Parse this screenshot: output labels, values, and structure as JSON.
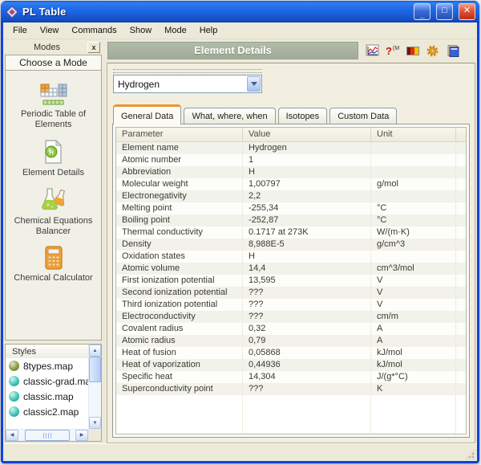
{
  "window": {
    "title": "PL Table",
    "controls": {
      "minimize": "_",
      "maximize": "□",
      "close": "✕"
    }
  },
  "menu": {
    "items": [
      "File",
      "View",
      "Commands",
      "Show",
      "Mode",
      "Help"
    ]
  },
  "sidebar": {
    "caption": "Modes",
    "close_label": "x",
    "header": "Choose a Mode",
    "modes": [
      {
        "label": "Periodic Table of Elements",
        "icon": "periodic-table-icon"
      },
      {
        "label": "Element Details",
        "icon": "element-details-icon"
      },
      {
        "label": "Chemical Equations Balancer",
        "icon": "flasks-icon"
      },
      {
        "label": "Chemical Calculator",
        "icon": "calculator-icon"
      }
    ],
    "styles_panel": {
      "title": "Styles",
      "items": [
        {
          "name": "8types.map",
          "color": "#8d9b43",
          "gloss": "#dfe8bf",
          "edge": "#57651f"
        },
        {
          "name": "classic-grad.map",
          "color": "#44c4b7",
          "gloss": "#d3f4ef",
          "edge": "#17776d"
        },
        {
          "name": "classic.map",
          "color": "#44c4b7",
          "gloss": "#d3f4ef",
          "edge": "#17776d"
        },
        {
          "name": "classic2.map",
          "color": "#44c4b7",
          "gloss": "#d3f4ef",
          "edge": "#17776d"
        }
      ]
    }
  },
  "main": {
    "header": "Element Details",
    "toolbar_icons": [
      "chart-icon",
      "query-language-icon",
      "flag-icon",
      "settings-gear-icon",
      "notebook-icon"
    ],
    "element_select": {
      "value": "Hydrogen"
    },
    "tabs": [
      {
        "label": "General Data",
        "active": true
      },
      {
        "label": "What, where, when",
        "active": false
      },
      {
        "label": "Isotopes",
        "active": false
      },
      {
        "label": "Custom Data",
        "active": false
      }
    ],
    "table": {
      "columns": [
        "Parameter",
        "Value",
        "Unit"
      ],
      "rows": [
        [
          "Element name",
          "Hydrogen",
          ""
        ],
        [
          "Atomic number",
          "1",
          ""
        ],
        [
          "Abbreviation",
          "H",
          ""
        ],
        [
          "Molecular weight",
          "1,00797",
          "g/mol"
        ],
        [
          "Electronegativity",
          "2,2",
          ""
        ],
        [
          "Melting point",
          "-255,34",
          "°C"
        ],
        [
          "Boiling point",
          "-252,87",
          "°C"
        ],
        [
          "Thermal conductivity",
          "0.1717 at 273K",
          "W/(m·K)"
        ],
        [
          "Density",
          "8,988E-5",
          "g/cm^3"
        ],
        [
          "Oxidation states",
          "H",
          ""
        ],
        [
          "Atomic volume",
          "14,4",
          "cm^3/mol"
        ],
        [
          "First ionization potential",
          "13,595",
          "V"
        ],
        [
          "Second ionization potential",
          "???",
          "V"
        ],
        [
          "Third ionization potential",
          "???",
          "V"
        ],
        [
          "Electroconductivity",
          "???",
          "cm/m"
        ],
        [
          "Covalent radius",
          "0,32",
          "A"
        ],
        [
          "Atomic radius",
          "0,79",
          "A"
        ],
        [
          "Heat of fusion",
          "0,05868",
          "kJ/mol"
        ],
        [
          "Heat of vaporization",
          "0,44936",
          "kJ/mol"
        ],
        [
          "Specific heat",
          "14,304",
          "J/(g*°C)"
        ],
        [
          "Superconductivity point",
          "???",
          "K"
        ]
      ]
    }
  },
  "colors": {
    "titlebar_blue": "#1a5edd",
    "frame_blue": "#1242d6",
    "chrome_beige": "#ece9d8",
    "header_sage": "#a7b09d",
    "active_tab_accent": "#e79734"
  }
}
